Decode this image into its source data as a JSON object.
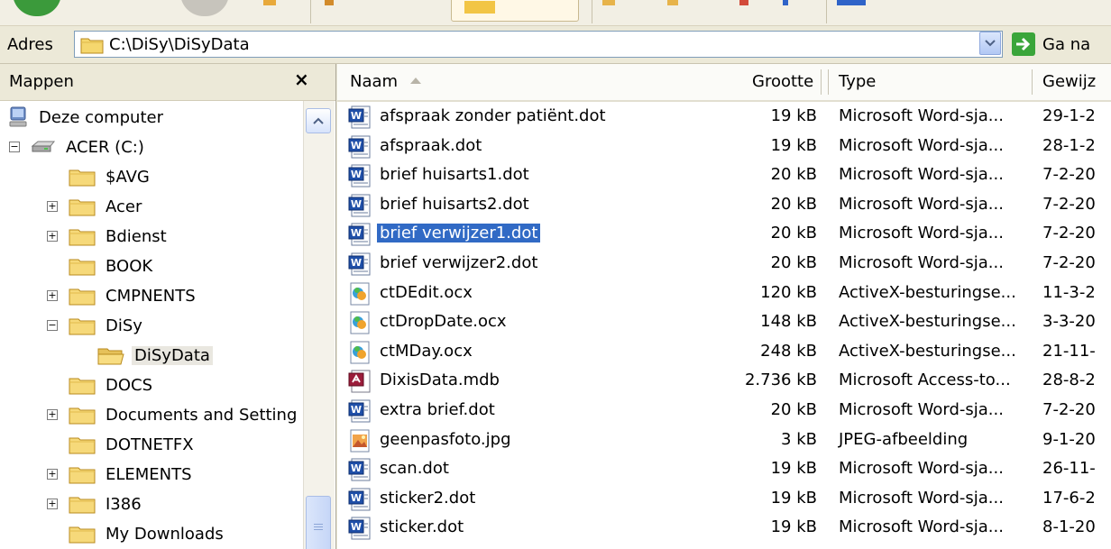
{
  "address": {
    "label": "Adres",
    "path": "C:\\DiSy\\DiSyData",
    "go_label": "Ga na"
  },
  "sidebar": {
    "title": "Mappen",
    "close": "×",
    "items": [
      {
        "label": "Deze computer",
        "icon": "computer-icon",
        "toggle": ""
      },
      {
        "label": "ACER (C:)",
        "icon": "drive-icon",
        "toggle": "−"
      },
      {
        "label": "$AVG",
        "icon": "folder-icon",
        "toggle": ""
      },
      {
        "label": "Acer",
        "icon": "folder-icon",
        "toggle": "+"
      },
      {
        "label": "Bdienst",
        "icon": "folder-icon",
        "toggle": "+"
      },
      {
        "label": "BOOK",
        "icon": "folder-icon",
        "toggle": ""
      },
      {
        "label": "CMPNENTS",
        "icon": "folder-icon",
        "toggle": "+"
      },
      {
        "label": "DiSy",
        "icon": "folder-icon",
        "toggle": "−"
      },
      {
        "label": "DiSyData",
        "icon": "folder-open-icon",
        "toggle": "",
        "selected": true
      },
      {
        "label": "DOCS",
        "icon": "folder-icon",
        "toggle": ""
      },
      {
        "label": "Documents and Setting",
        "icon": "folder-icon",
        "toggle": "+"
      },
      {
        "label": "DOTNETFX",
        "icon": "folder-icon",
        "toggle": ""
      },
      {
        "label": "ELEMENTS",
        "icon": "folder-icon",
        "toggle": "+"
      },
      {
        "label": "I386",
        "icon": "folder-icon",
        "toggle": "+"
      },
      {
        "label": "My Downloads",
        "icon": "folder-icon",
        "toggle": ""
      }
    ]
  },
  "columns": {
    "name": "Naam",
    "size": "Grootte",
    "type": "Type",
    "date": "Gewijz"
  },
  "files": [
    {
      "name": "afspraak zonder patiënt.dot",
      "size": "19 kB",
      "type": "Microsoft Word-sja...",
      "date": "29-1-2",
      "icon": "word-template-icon"
    },
    {
      "name": "afspraak.dot",
      "size": "19 kB",
      "type": "Microsoft Word-sja...",
      "date": "28-1-2",
      "icon": "word-template-icon"
    },
    {
      "name": "brief huisarts1.dot",
      "size": "20 kB",
      "type": "Microsoft Word-sja...",
      "date": "7-2-20",
      "icon": "word-template-icon"
    },
    {
      "name": "brief huisarts2.dot",
      "size": "20 kB",
      "type": "Microsoft Word-sja...",
      "date": "7-2-20",
      "icon": "word-template-icon"
    },
    {
      "name": "brief verwijzer1.dot",
      "size": "20 kB",
      "type": "Microsoft Word-sja...",
      "date": "7-2-20",
      "icon": "word-template-icon",
      "selected": true
    },
    {
      "name": "brief verwijzer2.dot",
      "size": "20 kB",
      "type": "Microsoft Word-sja...",
      "date": "7-2-20",
      "icon": "word-template-icon"
    },
    {
      "name": "ctDEdit.ocx",
      "size": "120 kB",
      "type": "ActiveX-besturingse...",
      "date": "11-3-2",
      "icon": "activex-icon"
    },
    {
      "name": "ctDropDate.ocx",
      "size": "148 kB",
      "type": "ActiveX-besturingse...",
      "date": "3-3-20",
      "icon": "activex-icon"
    },
    {
      "name": "ctMDay.ocx",
      "size": "248 kB",
      "type": "ActiveX-besturingse...",
      "date": "21-11-",
      "icon": "activex-icon"
    },
    {
      "name": "DixisData.mdb",
      "size": "2.736 kB",
      "type": "Microsoft Access-to...",
      "date": "28-8-2",
      "icon": "access-icon"
    },
    {
      "name": "extra brief.dot",
      "size": "20 kB",
      "type": "Microsoft Word-sja...",
      "date": "7-2-20",
      "icon": "word-template-icon"
    },
    {
      "name": "geenpasfoto.jpg",
      "size": "3 kB",
      "type": "JPEG-afbeelding",
      "date": "9-1-20",
      "icon": "jpeg-icon"
    },
    {
      "name": "scan.dot",
      "size": "19 kB",
      "type": "Microsoft Word-sja...",
      "date": "26-11-",
      "icon": "word-template-icon"
    },
    {
      "name": "sticker2.dot",
      "size": "19 kB",
      "type": "Microsoft Word-sja...",
      "date": "17-6-2",
      "icon": "word-template-icon"
    },
    {
      "name": "sticker.dot",
      "size": "19 kB",
      "type": "Microsoft Word-sja...",
      "date": "8-1-20",
      "icon": "word-template-icon"
    }
  ],
  "colors": {
    "selection": "#316ac5",
    "window_bg": "#ece9d8",
    "folder": "#f5d76e"
  }
}
